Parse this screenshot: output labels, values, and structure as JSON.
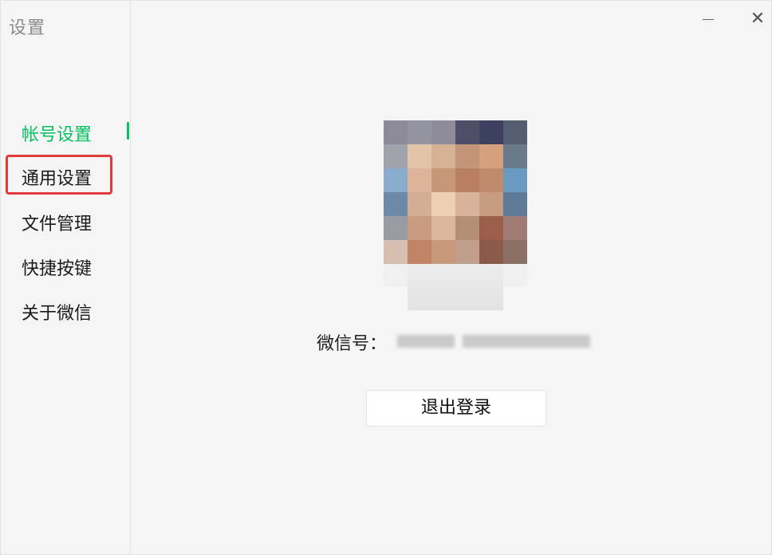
{
  "window": {
    "title": "设置",
    "minimize_icon": "minimize-icon",
    "close_icon": "close-icon",
    "close_glyph": "✕"
  },
  "sidebar": {
    "items": [
      {
        "label": "帐号设置",
        "active": true
      },
      {
        "label": "通用设置",
        "active": false,
        "highlighted": true
      },
      {
        "label": "文件管理",
        "active": false
      },
      {
        "label": "快捷按键",
        "active": false
      },
      {
        "label": "关于微信",
        "active": false
      }
    ]
  },
  "account": {
    "wechat_id_label": "微信号：",
    "logout_label": "退出登录"
  },
  "colors": {
    "accent": "#07c160",
    "highlight": "#e03a3a"
  }
}
